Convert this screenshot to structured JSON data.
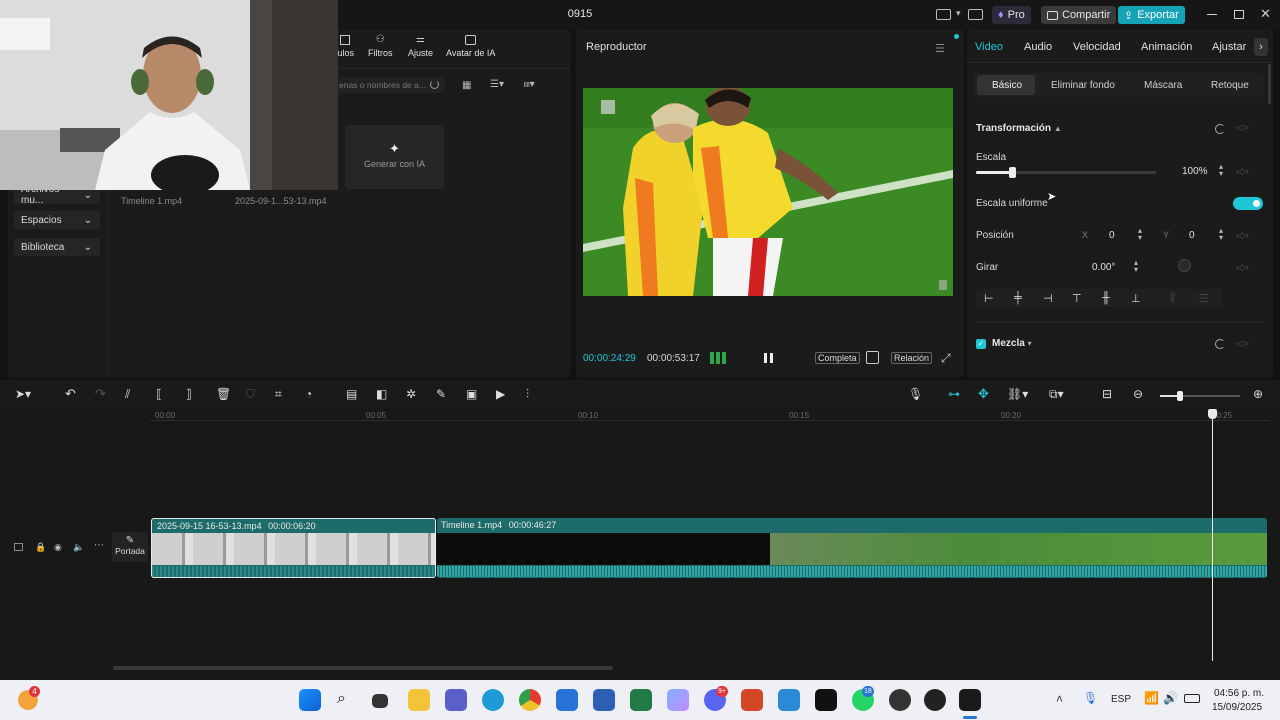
{
  "window": {
    "title": "0915"
  },
  "top_buttons": {
    "pro": "Pro",
    "share": "Compartir",
    "export": "Exportar"
  },
  "media": {
    "tabs": [
      "tulos",
      "Filtros",
      "Ajuste",
      "Avatar de IA"
    ],
    "search_placeholder": "enas o nombres de a...",
    "sidebar": [
      {
        "label": "Archivos mu..."
      },
      {
        "label": "Espacios"
      },
      {
        "label": "Biblioteca"
      }
    ],
    "ai_card": "Generar con IA",
    "files": [
      "Timeline 1.mp4",
      "2025-09-1...53-13.mp4"
    ]
  },
  "player": {
    "title": "Reproductor",
    "current_time": "00:00:24:29",
    "total_time": "00:00:53:17",
    "full_label": "Completa",
    "ratio_label": "Relación"
  },
  "props": {
    "tabs": [
      "Video",
      "Audio",
      "Velocidad",
      "Animación",
      "Ajustar"
    ],
    "subtabs": [
      "Básico",
      "Eliminar fondo",
      "Máscara",
      "Retoque"
    ],
    "section": "Transformación",
    "scale_label": "Escala",
    "scale_value": "100%",
    "scale_fraction": 0.2,
    "uniform_label": "Escala uniforme",
    "position_label": "Posición",
    "pos_x_label": "X",
    "pos_x": "0",
    "pos_y_label": "Y",
    "pos_y": "0",
    "rotate_label": "Girar",
    "rotate_value": "0.00°",
    "blend_label": "Mezcla",
    "accent": "#1fc6d8"
  },
  "timeline": {
    "ticks": [
      "00:00",
      "00:05",
      "00:10",
      "00:15",
      "00:20",
      "00:25"
    ],
    "cover_label": "Portada",
    "clip1": {
      "name": "2025-09-15 16-53-13.mp4",
      "duration": "00:00:06:20"
    },
    "clip2": {
      "name": "Timeline 1.mp4",
      "duration": "00:00:46:27"
    }
  },
  "taskbar": {
    "lang": "ESP",
    "time": "04:56 p. m.",
    "date": "15/09/2025",
    "weather_badge": "4",
    "discord_badge": "9+",
    "whatsapp_badge": "18"
  }
}
